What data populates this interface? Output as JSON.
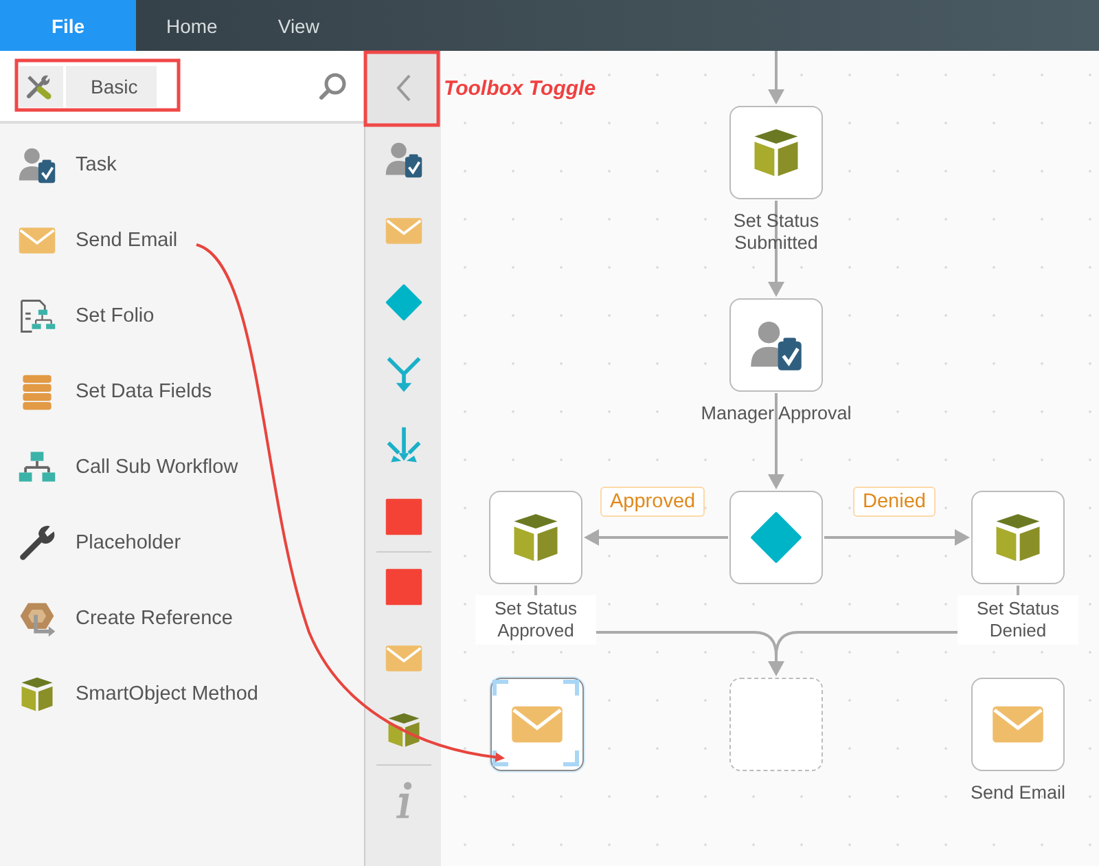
{
  "menu_tabs": [
    {
      "label": "File",
      "selected": true
    },
    {
      "label": "Home",
      "selected": false
    },
    {
      "label": "View",
      "selected": false
    }
  ],
  "toolbox": {
    "breadcrumb": "Basic",
    "items": [
      {
        "label": "Task",
        "kind": "task"
      },
      {
        "label": "Send Email",
        "kind": "email"
      },
      {
        "label": "Set Folio",
        "kind": "folio"
      },
      {
        "label": "Set Data Fields",
        "kind": "data-fields"
      },
      {
        "label": "Call Sub Workflow",
        "kind": "sub-workflow"
      },
      {
        "label": "Placeholder",
        "kind": "wrench"
      },
      {
        "label": "Create Reference",
        "kind": "reference"
      },
      {
        "label": "SmartObject Method",
        "kind": "smartobject"
      }
    ]
  },
  "toolstrip": {
    "groups": [
      [
        {
          "kind": "task"
        },
        {
          "kind": "email"
        },
        {
          "kind": "decision"
        },
        {
          "kind": "split"
        },
        {
          "kind": "merge"
        },
        {
          "kind": "stop"
        }
      ],
      [
        {
          "kind": "stop"
        },
        {
          "kind": "email"
        },
        {
          "kind": "smartobject"
        }
      ],
      [
        {
          "kind": "info"
        }
      ]
    ]
  },
  "canvas": {
    "nodes": [
      {
        "kind": "smartobject",
        "label": "Set Status Submitted",
        "selected": false
      },
      {
        "kind": "task",
        "label": "Manager Approval",
        "selected": false
      },
      {
        "kind": "smartobject",
        "label": "Set Status Approved",
        "selected": false
      },
      {
        "kind": "decision",
        "selected": false
      },
      {
        "kind": "smartobject",
        "label": "Set Status Denied",
        "selected": false
      },
      {
        "kind": "email",
        "selected": true
      },
      {
        "kind": "drop-zone",
        "selected": false
      },
      {
        "kind": "email",
        "label": "Send Email",
        "selected": false
      }
    ],
    "branch_labels": [
      "Approved",
      "Denied"
    ]
  },
  "annotation": {
    "label": "Toolbox Toggle"
  }
}
